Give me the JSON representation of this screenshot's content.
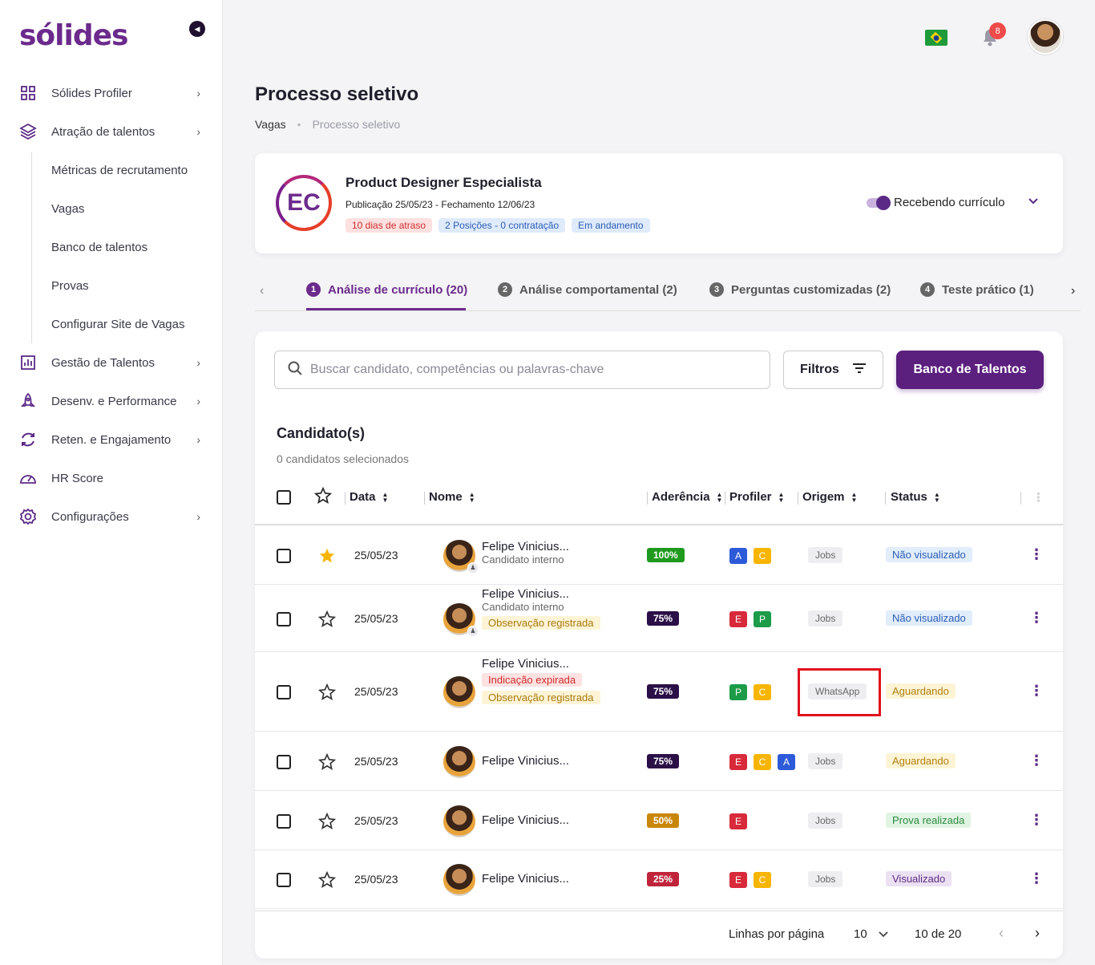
{
  "brand": {
    "logo_text": "sólides"
  },
  "sidebar": {
    "items": [
      {
        "label": "Sólides Profiler",
        "icon": "grid-icon"
      },
      {
        "label": "Atração de talentos",
        "icon": "layers-icon"
      },
      {
        "label": "Gestão de Talentos",
        "icon": "bar-chart-icon"
      },
      {
        "label": "Desenv. e Performance",
        "icon": "rocket-icon"
      },
      {
        "label": "Reten. e Engajamento",
        "icon": "refresh-icon"
      },
      {
        "label": "HR Score",
        "icon": "gauge-icon"
      },
      {
        "label": "Configurações",
        "icon": "gear-icon"
      }
    ],
    "subitems": [
      "Métricas de recrutamento",
      "Vagas",
      "Banco de talentos",
      "Provas",
      "Configurar Site de Vagas"
    ]
  },
  "topbar": {
    "notification_count": "8"
  },
  "page": {
    "title": "Processo seletivo",
    "breadcrumb": [
      "Vagas",
      "Processo seletivo"
    ]
  },
  "job": {
    "initials": "EC",
    "title": "Product Designer Especialista",
    "dates": "Publicação 25/05/23 - Fechamento 12/06/23",
    "tags": [
      "10 dias de atraso",
      "2 Posições - 0 contratação",
      "Em andamento"
    ],
    "receiving_label": "Recebendo currículo"
  },
  "tabs": [
    {
      "num": "1",
      "label": "Análise de currículo (20)"
    },
    {
      "num": "2",
      "label": "Análise comportamental (2)"
    },
    {
      "num": "3",
      "label": "Perguntas customizadas (2)"
    },
    {
      "num": "4",
      "label": "Teste prático (1)"
    }
  ],
  "search": {
    "placeholder": "Buscar candidato, competências ou palavras-chave"
  },
  "buttons": {
    "filters": "Filtros",
    "talent_bank": "Banco de Talentos"
  },
  "candidates": {
    "title": "Candidato(s)",
    "selected": "0 candidatos selecionados",
    "columns": {
      "date": "Data",
      "name": "Nome",
      "adherence": "Aderência",
      "profiler": "Profiler",
      "origin": "Origem",
      "status": "Status"
    },
    "rows": [
      {
        "date": "25/05/23",
        "name": "Felipe Vinicius...",
        "sub": "Candidato interno",
        "obs": "",
        "ind": "",
        "pct": "100%",
        "pct_color": "#1f9a1f",
        "profiler": [
          "A",
          "C"
        ],
        "origin": "Jobs",
        "status": "Não visualizado",
        "status_class": "st-blue",
        "starred": true
      },
      {
        "date": "25/05/23",
        "name": "Felipe Vinicius...",
        "sub": "Candidato interno",
        "obs": "Observação registrada",
        "ind": "",
        "pct": "75%",
        "pct_color": "#2b0f47",
        "profiler": [
          "E",
          "P"
        ],
        "origin": "Jobs",
        "status": "Não visualizado",
        "status_class": "st-blue",
        "starred": false
      },
      {
        "date": "25/05/23",
        "name": "Felipe Vinicius...",
        "sub": "",
        "obs": "Observação registrada",
        "ind": "Indicação expirada",
        "pct": "75%",
        "pct_color": "#2b0f47",
        "profiler": [
          "P",
          "C"
        ],
        "origin": "WhatsApp",
        "status": "Aguardando",
        "status_class": "st-yellow",
        "starred": false
      },
      {
        "date": "25/05/23",
        "name": "Felipe Vinicius...",
        "sub": "",
        "obs": "",
        "ind": "",
        "pct": "75%",
        "pct_color": "#2b0f47",
        "profiler": [
          "E",
          "C",
          "A"
        ],
        "origin": "Jobs",
        "status": "Aguardando",
        "status_class": "st-yellow",
        "starred": false
      },
      {
        "date": "25/05/23",
        "name": "Felipe Vinicius...",
        "sub": "",
        "obs": "",
        "ind": "",
        "pct": "50%",
        "pct_color": "#c9870a",
        "profiler": [
          "E"
        ],
        "origin": "Jobs",
        "status": "Prova realizada",
        "status_class": "st-green",
        "starred": false
      },
      {
        "date": "25/05/23",
        "name": "Felipe Vinicius...",
        "sub": "",
        "obs": "",
        "ind": "",
        "pct": "25%",
        "pct_color": "#c0243a",
        "profiler": [
          "E",
          "C"
        ],
        "origin": "Jobs",
        "status": "Visualizado",
        "status_class": "st-purple",
        "starred": false
      }
    ]
  },
  "pagination": {
    "rows_label": "Linhas por página",
    "rows_value": "10",
    "range": "10 de 20"
  }
}
